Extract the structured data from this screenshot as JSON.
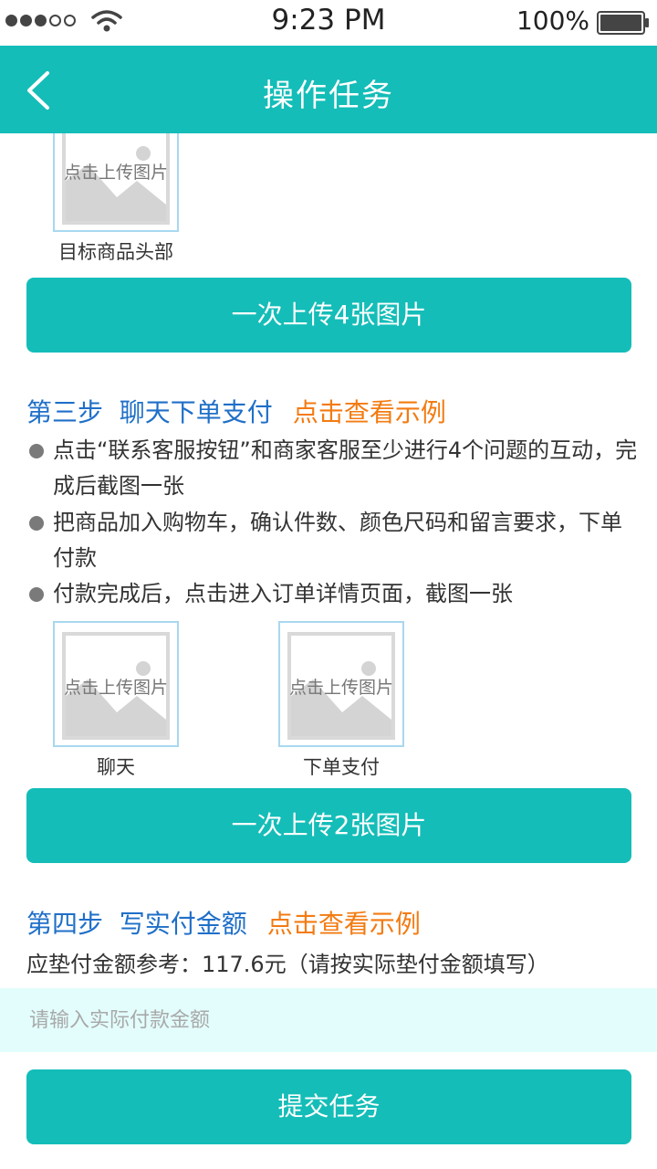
{
  "status_bar": {
    "time": "9:23 PM",
    "battery": "100%"
  },
  "header": {
    "title": "操作任务",
    "back_icon": "chevron-left-icon"
  },
  "tile_hint": "点击上传图片",
  "step2": {
    "tiles": [
      {
        "label": "目标商品头部"
      }
    ],
    "upload_button": "一次上传4张图片"
  },
  "step3": {
    "title": "第三步  聊天下单支付",
    "example_link": "点击查看示例",
    "instructions": [
      "点击“联系客服按钮”和商家客服至少进行4个问题的互动，完成后截图一张",
      "把商品加入购物车，确认件数、颜色尺码和留言要求，下单付款",
      "付款完成后，点击进入订单详情页面，截图一张"
    ],
    "tiles": [
      {
        "label": "聊天"
      },
      {
        "label": "下单支付"
      }
    ],
    "upload_button": "一次上传2张图片"
  },
  "step4": {
    "title": "第四步  写实付金额",
    "example_link": "点击查看示例",
    "reference_text": "应垫付金额参考：117.6元（请按实际垫付金额填写）",
    "input_placeholder": "请输入实际付款金额",
    "input_value": ""
  },
  "submit_button": "提交任务",
  "colors": {
    "accent": "#14bdb8",
    "step_title": "#1f6fc8",
    "link": "#f37b12",
    "input_bg": "#e2fdfc"
  }
}
